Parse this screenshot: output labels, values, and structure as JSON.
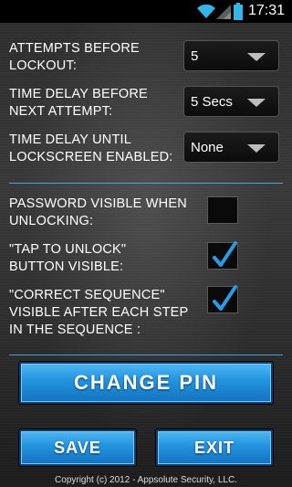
{
  "status_bar": {
    "time": "17:31",
    "icons": [
      "wifi-icon",
      "signal-icon",
      "battery-icon"
    ]
  },
  "settings": {
    "attempts": {
      "label_line1": "ATTEMPTS BEFORE",
      "label_line2": "LOCKOUT:",
      "value": "5"
    },
    "delay_next": {
      "label_line1": "TIME DELAY BEFORE",
      "label_line2": "NEXT ATTEMPT:",
      "value": "5 Secs"
    },
    "delay_lockscreen": {
      "label_line1": "TIME DELAY UNTIL",
      "label_line2": "LOCKSCREEN ENABLED:",
      "value": "None"
    }
  },
  "options": {
    "password_visible": {
      "label_line1": "PASSWORD VISIBLE WHEN",
      "label_line2": "UNLOCKING:",
      "checked": false
    },
    "tap_to_unlock": {
      "label_line1": "\"TAP TO UNLOCK\"",
      "label_line2": "BUTTON VISIBLE:",
      "checked": true
    },
    "correct_sequence": {
      "label_line1": "\"CORRECT SEQUENCE\"",
      "label_line2": "VISIBLE AFTER EACH STEP",
      "label_line3": "IN THE SEQUENCE :",
      "checked": true
    }
  },
  "buttons": {
    "change_pin": "CHANGE PIN",
    "save": "SAVE",
    "exit": "EXIT"
  },
  "footer": {
    "copyright": "Copyright (c) 2012 - Appsolute Security, LLC."
  },
  "colors": {
    "accent": "#2a9be6",
    "divider": "#4aa3d6"
  }
}
